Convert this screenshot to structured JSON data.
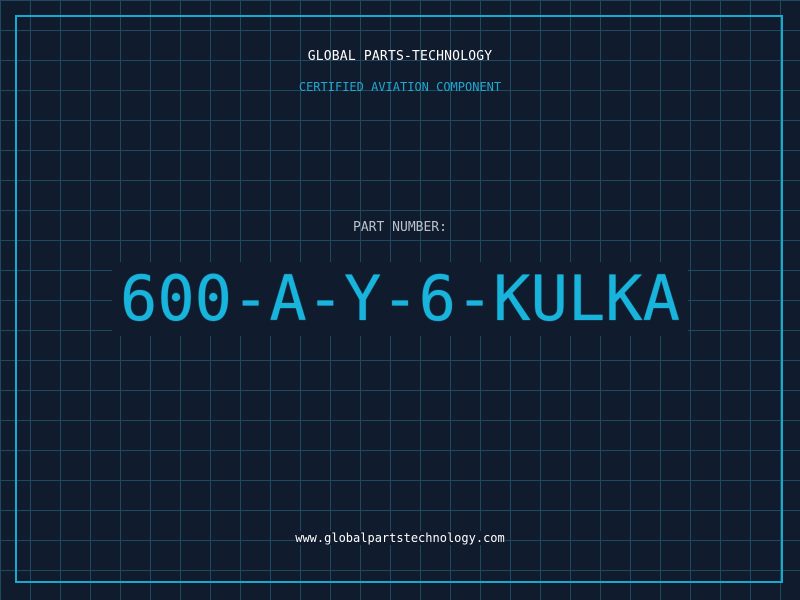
{
  "header": {
    "company": "GLOBAL PARTS-TECHNOLOGY",
    "tagline": "CERTIFIED AVIATION COMPONENT"
  },
  "part": {
    "label": "PART NUMBER:",
    "number": "600-A-Y-6-KULKA"
  },
  "footer": {
    "url": "www.globalpartstechnology.com"
  },
  "colors": {
    "background": "#111b2e",
    "grid": "#1d4a5e",
    "accent": "#19b4dc",
    "text": "#ffffff"
  }
}
